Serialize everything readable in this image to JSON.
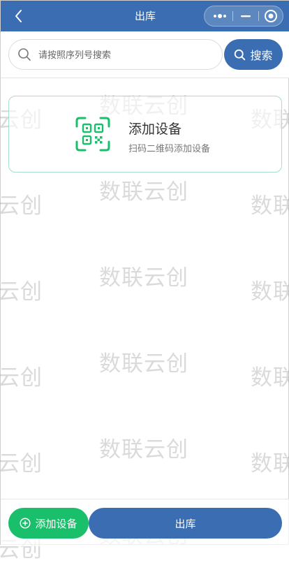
{
  "header": {
    "title": "出库",
    "back_icon": "chevron-left-icon",
    "capsule_icons": [
      "more-dots-icon",
      "minimize-icon",
      "target-icon"
    ],
    "bg_color": "#3a6db1"
  },
  "search": {
    "placeholder": "请按照序列号搜索",
    "value": "",
    "button_label": "搜索",
    "icon": "search-icon"
  },
  "add_card": {
    "title": "添加设备",
    "subtitle": "扫码二维码添加设备",
    "icon": "qr-scan-icon",
    "accent_color": "#19bf6a"
  },
  "watermark": {
    "text": "数联云创",
    "clipped_left": "云创",
    "clipped_right": "数联"
  },
  "footer": {
    "add_label": "添加设备",
    "add_icon": "plus-circle-icon",
    "add_color": "#19bf6a",
    "submit_label": "出库",
    "submit_color": "#3a6db1"
  }
}
